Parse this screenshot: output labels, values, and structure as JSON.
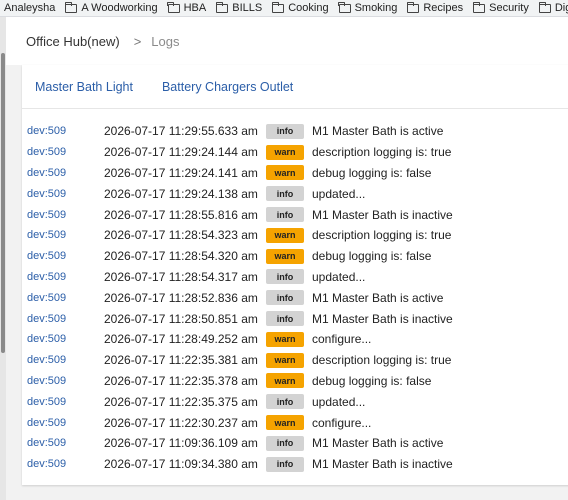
{
  "bookmarks": [
    {
      "label": "Analeysha",
      "icon": "none"
    },
    {
      "label": "A Woodworking",
      "icon": "folder-icon"
    },
    {
      "label": "HBA",
      "icon": "folder-icon"
    },
    {
      "label": "BILLS",
      "icon": "folder-icon"
    },
    {
      "label": "Cooking",
      "icon": "folder-icon"
    },
    {
      "label": "Smoking",
      "icon": "folder-icon"
    },
    {
      "label": "Recipes",
      "icon": "folder-icon"
    },
    {
      "label": "Security",
      "icon": "folder-icon"
    },
    {
      "label": "Digita",
      "icon": "folder-icon"
    }
  ],
  "breadcrumb": {
    "hub": "Office Hub(new)",
    "separator": ">",
    "current": "Logs"
  },
  "tabs": [
    {
      "label": "Master Bath Light"
    },
    {
      "label": "Battery Chargers Outlet"
    }
  ],
  "colors": {
    "link": "#2b5ea8",
    "warn": "#f5a300",
    "info": "#d3d3d3"
  },
  "logs": [
    {
      "device": "dev:509",
      "timestamp": "2026-07-17 11:29:55.633 am",
      "level": "info",
      "message": "M1 Master Bath is active"
    },
    {
      "device": "dev:509",
      "timestamp": "2026-07-17 11:29:24.144 am",
      "level": "warn",
      "message": "description logging is: true"
    },
    {
      "device": "dev:509",
      "timestamp": "2026-07-17 11:29:24.141 am",
      "level": "warn",
      "message": "debug logging is: false"
    },
    {
      "device": "dev:509",
      "timestamp": "2026-07-17 11:29:24.138 am",
      "level": "info",
      "message": "updated..."
    },
    {
      "device": "dev:509",
      "timestamp": "2026-07-17 11:28:55.816 am",
      "level": "info",
      "message": "M1 Master Bath is inactive"
    },
    {
      "device": "dev:509",
      "timestamp": "2026-07-17 11:28:54.323 am",
      "level": "warn",
      "message": "description logging is: true"
    },
    {
      "device": "dev:509",
      "timestamp": "2026-07-17 11:28:54.320 am",
      "level": "warn",
      "message": "debug logging is: false"
    },
    {
      "device": "dev:509",
      "timestamp": "2026-07-17 11:28:54.317 am",
      "level": "info",
      "message": "updated..."
    },
    {
      "device": "dev:509",
      "timestamp": "2026-07-17 11:28:52.836 am",
      "level": "info",
      "message": "M1 Master Bath is active"
    },
    {
      "device": "dev:509",
      "timestamp": "2026-07-17 11:28:50.851 am",
      "level": "info",
      "message": "M1 Master Bath is inactive"
    },
    {
      "device": "dev:509",
      "timestamp": "2026-07-17 11:28:49.252 am",
      "level": "warn",
      "message": "configure..."
    },
    {
      "device": "dev:509",
      "timestamp": "2026-07-17 11:22:35.381 am",
      "level": "warn",
      "message": "description logging is: true"
    },
    {
      "device": "dev:509",
      "timestamp": "2026-07-17 11:22:35.378 am",
      "level": "warn",
      "message": "debug logging is: false"
    },
    {
      "device": "dev:509",
      "timestamp": "2026-07-17 11:22:35.375 am",
      "level": "info",
      "message": "updated..."
    },
    {
      "device": "dev:509",
      "timestamp": "2026-07-17 11:22:30.237 am",
      "level": "warn",
      "message": "configure..."
    },
    {
      "device": "dev:509",
      "timestamp": "2026-07-17 11:09:36.109 am",
      "level": "info",
      "message": "M1 Master Bath is active"
    },
    {
      "device": "dev:509",
      "timestamp": "2026-07-17 11:09:34.380 am",
      "level": "info",
      "message": "M1 Master Bath is inactive"
    }
  ]
}
